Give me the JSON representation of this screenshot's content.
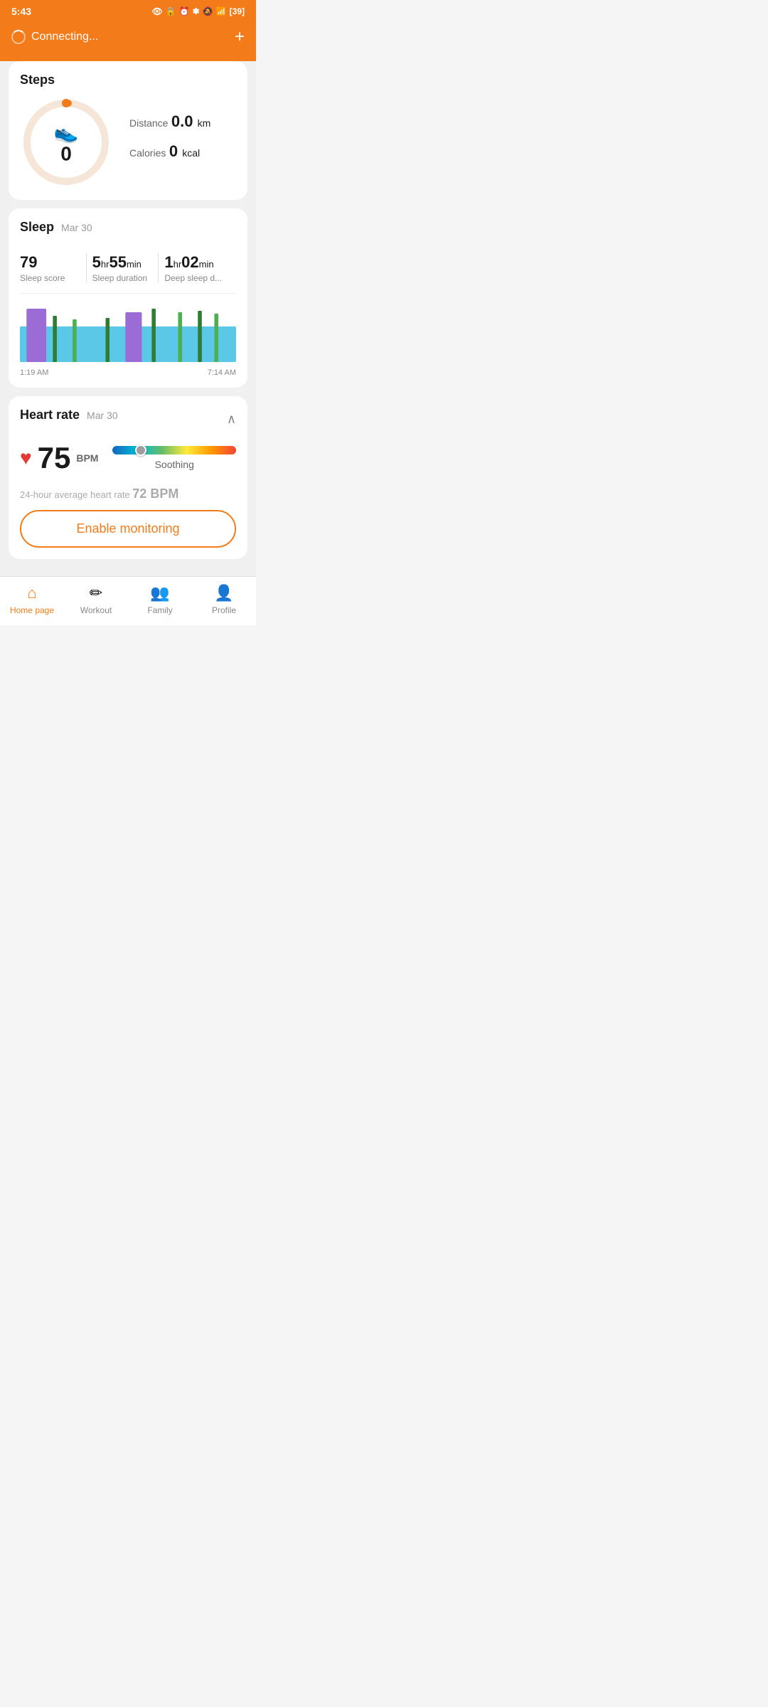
{
  "statusBar": {
    "time": "5:43",
    "battery": "39"
  },
  "header": {
    "connecting": "Connecting...",
    "plus": "+"
  },
  "steps": {
    "title": "Steps",
    "count": "0",
    "distance_label": "Distance",
    "distance_value": "0.0",
    "distance_unit": "km",
    "calories_label": "Calories",
    "calories_value": "0",
    "calories_unit": "kcal"
  },
  "sleep": {
    "title": "Sleep",
    "date": "Mar 30",
    "score_value": "79",
    "score_label": "Sleep score",
    "duration_hr": "5",
    "duration_min": "55",
    "duration_label": "Sleep duration",
    "deep_hr": "1",
    "deep_min": "02",
    "deep_label": "Deep sleep d...",
    "start_time": "1:19 AM",
    "end_time": "7:14 AM"
  },
  "heartRate": {
    "title": "Heart rate",
    "date": "Mar 30",
    "value": "75",
    "unit": "BPM",
    "scale_label": "Soothing",
    "avg_label": "24-hour average heart rate",
    "avg_value": "72",
    "avg_unit": "BPM",
    "enable_btn": "Enable monitoring"
  },
  "nav": {
    "home": "Home page",
    "workout": "Workout",
    "family": "Family",
    "profile": "Profile"
  }
}
